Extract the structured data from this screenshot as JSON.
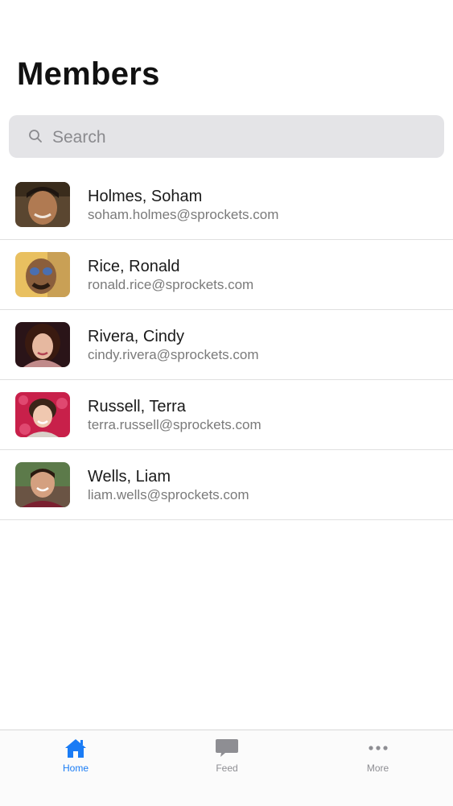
{
  "header": {
    "title": "Members"
  },
  "search": {
    "placeholder": "Search"
  },
  "members": [
    {
      "name": "Holmes, Soham",
      "email": "soham.holmes@sprockets.com"
    },
    {
      "name": "Rice, Ronald",
      "email": "ronald.rice@sprockets.com"
    },
    {
      "name": "Rivera, Cindy",
      "email": "cindy.rivera@sprockets.com"
    },
    {
      "name": "Russell, Terra",
      "email": "terra.russell@sprockets.com"
    },
    {
      "name": "Wells, Liam",
      "email": "liam.wells@sprockets.com"
    }
  ],
  "tabbar": {
    "tabs": [
      {
        "label": "Home",
        "icon": "home-icon",
        "active": true
      },
      {
        "label": "Feed",
        "icon": "chat-bubble-icon",
        "active": false
      },
      {
        "label": "More",
        "icon": "more-dots-icon",
        "active": false
      }
    ]
  },
  "colors": {
    "accent": "#1a7cf5",
    "inactive": "#8e8e93",
    "search_bg": "#e4e4e7"
  }
}
